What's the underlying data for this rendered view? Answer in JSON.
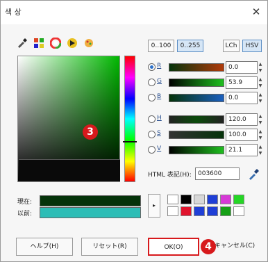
{
  "window": {
    "title": "색 상",
    "close_glyph": "✕"
  },
  "toolbar": {
    "icons": [
      "eyedropper-icon",
      "palette-icon",
      "color-wheel-icon",
      "triangle-wheel-icon",
      "crayon-icon"
    ]
  },
  "badges": {
    "picker": "3",
    "ok": "4"
  },
  "range_toggle": {
    "options": [
      "0..100",
      "0..255"
    ],
    "selected": "0..255"
  },
  "model_toggle": {
    "options": [
      "LCh",
      "HSV"
    ],
    "selected": "HSV"
  },
  "channels": [
    {
      "label": "R",
      "value": "0.0",
      "selected": true
    },
    {
      "label": "G",
      "value": "53.9",
      "selected": false
    },
    {
      "label": "B",
      "value": "0.0",
      "selected": false
    },
    {
      "label": "H",
      "value": "120.0",
      "selected": false
    },
    {
      "label": "S",
      "value": "100.0",
      "selected": false
    },
    {
      "label": "V",
      "value": "21.1",
      "selected": false
    }
  ],
  "html_notation": {
    "label": "HTML 表記(H):",
    "value": "003600"
  },
  "swatches": {
    "current_label": "現在:",
    "previous_label": "以前:",
    "current_color": "#05330a",
    "previous_color": "#2dbdb6"
  },
  "palette": {
    "arrow": "▸",
    "colors": [
      "#ffffff",
      "#000000",
      "#d8d8d8",
      "#1f3fd6",
      "#d63ad6",
      "#25d625",
      "#ffffff",
      "#e0142d",
      "#1f3fd6",
      "#1f3fd6",
      "#16a016",
      "#ffffff"
    ]
  },
  "buttons": {
    "help": "ヘルプ(H)",
    "reset": "リセット(R)",
    "ok": "OK(O)",
    "cancel": "キャンセル(C)"
  }
}
